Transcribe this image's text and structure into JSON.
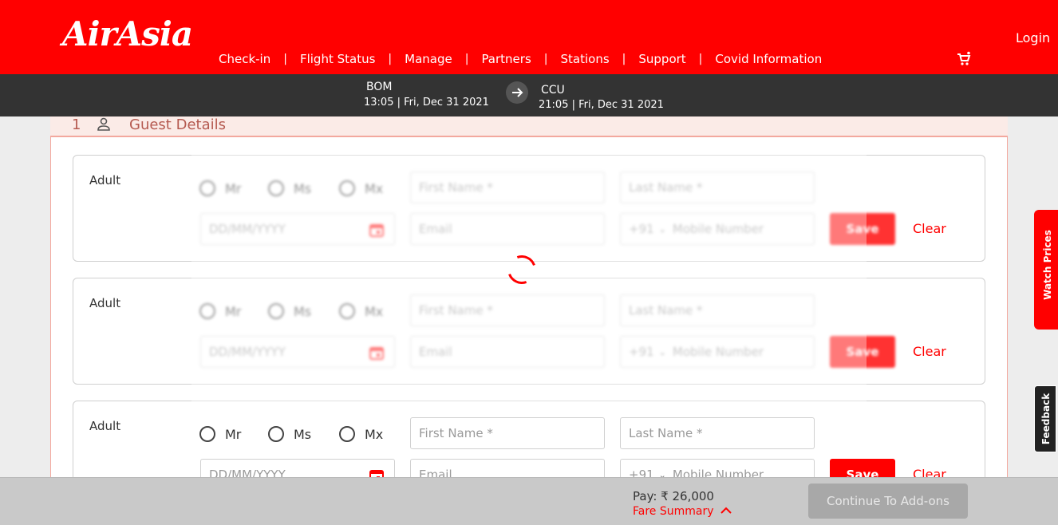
{
  "header": {
    "logo": "AirAsia",
    "nav": [
      "Check-in",
      "Flight Status",
      "Manage",
      "Partners",
      "Stations",
      "Support",
      "Covid Information"
    ],
    "separator": "|",
    "login": "Login",
    "cart_icon": "cart-icon"
  },
  "route": {
    "from_code": "BOM",
    "from_time": "13:05 | Fri, Dec 31 2021",
    "to_code": "CCU",
    "to_time": "21:05 | Fri, Dec 31 2021",
    "arrow_icon": "arrow-right-icon"
  },
  "guest_section": {
    "number": "1",
    "title": "Guest Details",
    "icon": "person-icon"
  },
  "passengers": [
    {
      "type": "Adult"
    },
    {
      "type": "Adult"
    },
    {
      "type": "Adult"
    }
  ],
  "form": {
    "titles": [
      "Mr",
      "Ms",
      "Mx"
    ],
    "first_name_placeholder": "First Name *",
    "last_name_placeholder": "Last Name *",
    "dob_placeholder": "DD/MM/YYYY",
    "email_placeholder": "Email",
    "country_code": "+91",
    "mobile_placeholder": "Mobile Number",
    "save_label": "Save",
    "clear_label": "Clear"
  },
  "side_tabs": {
    "watch_prices": "Watch Prices",
    "feedback": "Feedback"
  },
  "footer": {
    "pay": "Pay: ₹ 26,000",
    "fare_summary": "Fare Summary",
    "continue": "Continue To Add-ons"
  },
  "colors": {
    "brand_red": "#ff0000",
    "route_bar": "#333333"
  }
}
